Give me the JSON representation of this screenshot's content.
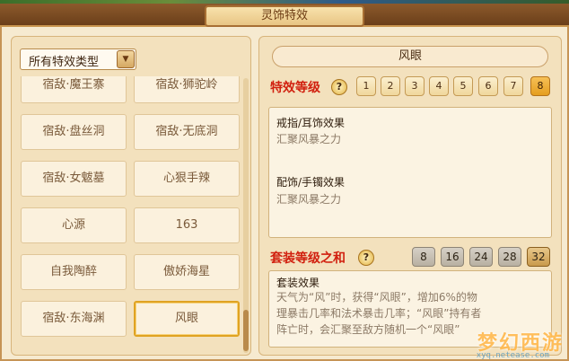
{
  "window": {
    "title": "灵饰特效"
  },
  "filter": {
    "selected": "所有特效类型"
  },
  "effect_list": [
    "宿敌·魔王寨",
    "宿敌·狮驼岭",
    "宿敌·盘丝洞",
    "宿敌·无底洞",
    "宿敌·女魃墓",
    "心狠手辣",
    "心源",
    "163",
    "自我陶醉",
    "傲娇海星",
    "宿敌·东海渊",
    "风眼"
  ],
  "selected_effect": "风眼",
  "effect_level": {
    "label": "特效等级",
    "help": "?",
    "levels": [
      "1",
      "2",
      "3",
      "4",
      "5",
      "6",
      "7",
      "8"
    ],
    "active_index": 7
  },
  "effect_box": {
    "ring_title": "戒指/耳饰效果",
    "ring_text": "汇聚风暴之力",
    "bracelet_title": "配饰/手镯效果",
    "bracelet_text": "汇聚风暴之力"
  },
  "set_level": {
    "label": "套装等级之和",
    "help": "?",
    "levels": [
      "8",
      "16",
      "24",
      "28",
      "32"
    ],
    "active_index": 4
  },
  "set_box": {
    "title": "套装效果",
    "line1": "天气为“风”时，获得“风眼”，增加6%的物",
    "line2": "理暴击几率和法术暴击几率；“风眼”持有者",
    "line3": "阵亡时，会汇聚至敌方随机一个“风眼”"
  },
  "watermark": {
    "logo": "梦幻西游",
    "url": "xyq.netease.com"
  },
  "colors": {
    "accent": "#e59e1f",
    "red_label": "#d1200f"
  }
}
